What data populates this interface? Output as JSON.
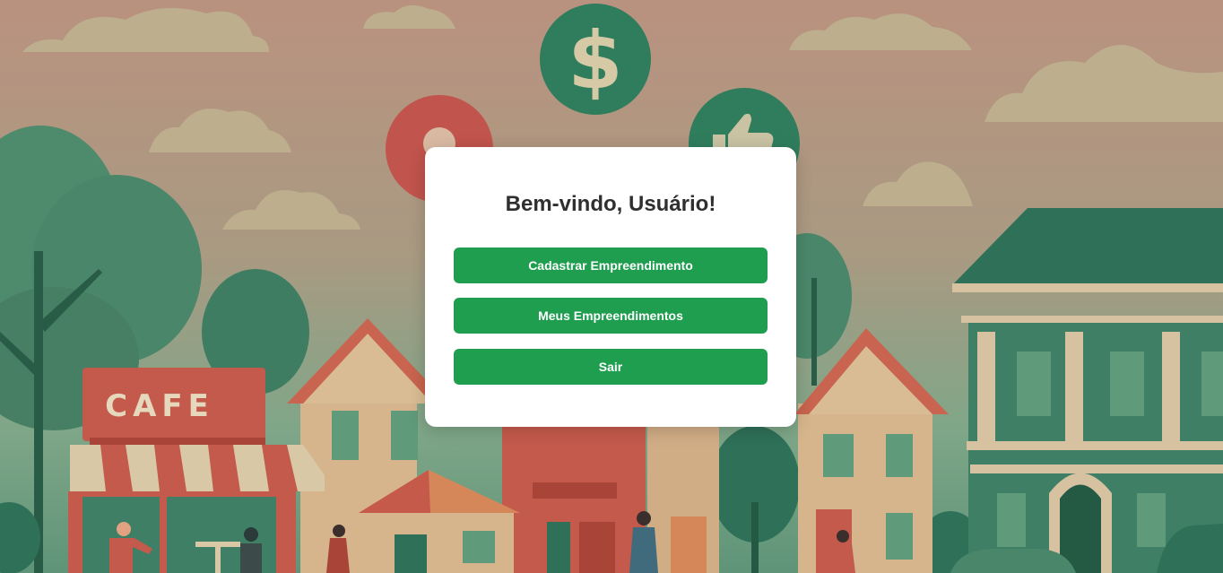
{
  "background": {
    "cafe_sign": "CAFE",
    "dollar_symbol": "$",
    "colors": {
      "sky": "#b89682",
      "green_dark": "#2f6e58",
      "green_mid": "#4f8f72",
      "brick": "#c45a4c",
      "sand": "#d6b58c",
      "cloud": "#bdaf8e"
    }
  },
  "card": {
    "title": "Bem-vindo, Usuário!",
    "buttons": {
      "register_label": "Cadastrar Empreendimento",
      "my_businesses_label": "Meus Empreendimentos",
      "logout_label": "Sair"
    },
    "button_color": "#1e9e4e"
  }
}
